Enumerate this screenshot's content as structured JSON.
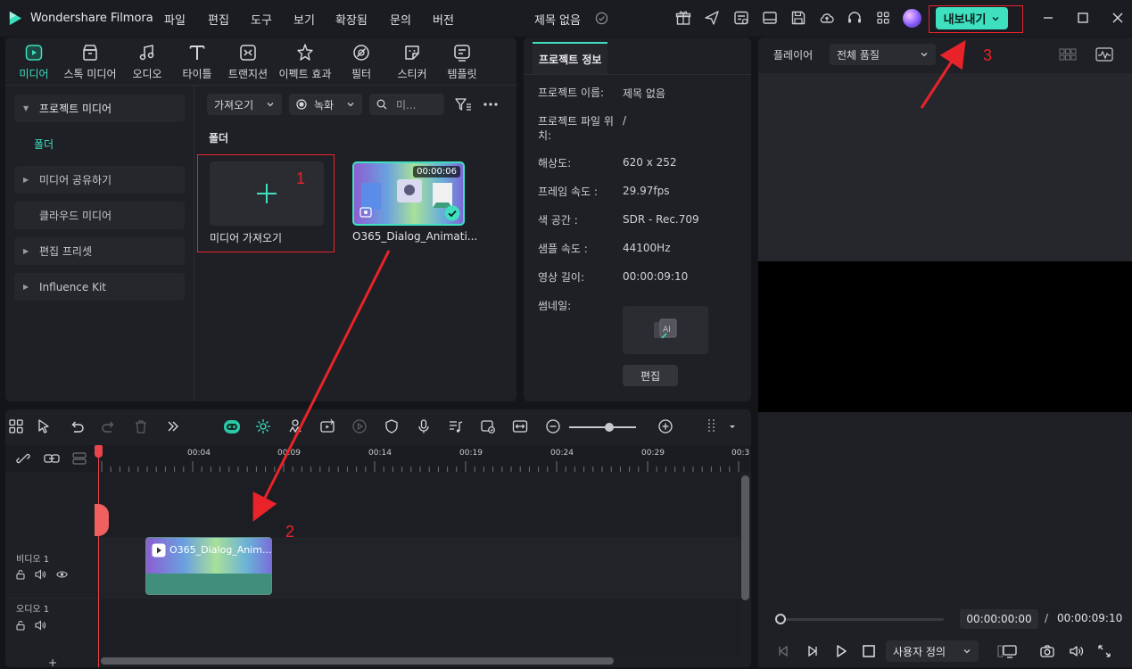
{
  "app": {
    "name": "Wondershare Filmora",
    "project_title": "제목 없음",
    "export_label": "내보내기"
  },
  "menu": [
    "파일",
    "편집",
    "도구",
    "보기",
    "확장됨",
    "문의",
    "버전"
  ],
  "media_tabs": [
    {
      "label": "미디어",
      "icon": "media-icon",
      "active": true
    },
    {
      "label": "스톡 미디어",
      "icon": "stock-media-icon"
    },
    {
      "label": "오디오",
      "icon": "music-note-icon"
    },
    {
      "label": "타이틀",
      "icon": "title-t-icon"
    },
    {
      "label": "트랜지션",
      "icon": "transition-icon"
    },
    {
      "label": "이펙트 효과",
      "icon": "effects-icon"
    },
    {
      "label": "필터",
      "icon": "filter-icon"
    },
    {
      "label": "스티커",
      "icon": "sticker-icon"
    },
    {
      "label": "템플릿",
      "icon": "template-icon"
    }
  ],
  "sidebar": {
    "project_media": "프로젝트 미디어",
    "folder": "폴더",
    "shared_media": "미디어 공유하기",
    "cloud_media": "클라우드 미디어",
    "edit_presets": "편집 프리셋",
    "influence_kit": "Influence Kit"
  },
  "media_toolbar": {
    "import": "가져오기",
    "record": "녹화",
    "search_placeholder": "미..."
  },
  "media_area": {
    "folder_label": "폴더",
    "import_tile_label": "미디어 가져오기",
    "clip_name": "O365_Dialog_Animati...",
    "clip_duration": "00:00:06"
  },
  "annotations": {
    "n1": "1",
    "n2": "2",
    "n3": "3"
  },
  "project_info": {
    "tab": "프로젝트 정보",
    "rows": [
      {
        "label": "프로젝트 이름:",
        "value": "제목 없음"
      },
      {
        "label": "프로젝트 파일 위치:",
        "value": "/"
      },
      {
        "label": "해상도:",
        "value": "620 x 252"
      },
      {
        "label": "프레임 속도 :",
        "value": "29.97fps"
      },
      {
        "label": "색 공간 :",
        "value": "SDR - Rec.709"
      },
      {
        "label": "샘플 속도 :",
        "value": "44100Hz"
      },
      {
        "label": "영상 길이:",
        "value": "00:00:09:10"
      }
    ],
    "thumbnail_label": "썸네일:",
    "edit_button": "편집"
  },
  "player": {
    "label": "플레이어",
    "quality": "전체 품질",
    "current_time": "00:00:00:00",
    "separator": "/",
    "total_time": "00:00:09:10",
    "zoom_option": "사용자 정의"
  },
  "timeline": {
    "ruler": [
      "00:04",
      "00:09",
      "00:14",
      "00:19",
      "00:24",
      "00:29",
      "00:3"
    ],
    "video_track": "비디오 1",
    "audio_track": "오디오 1",
    "clip_title": "O365_Dialog_Anim...",
    "add_track": "+"
  },
  "colors": {
    "accent": "#3ee0c0",
    "annotation": "#e8232a",
    "playhead": "#e8454d"
  }
}
